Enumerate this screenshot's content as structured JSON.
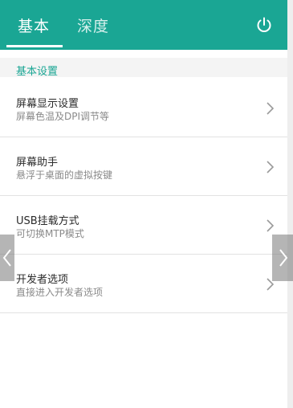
{
  "header": {
    "tabs": [
      {
        "label": "基本"
      },
      {
        "label": "深度"
      }
    ],
    "power_icon": "power-icon",
    "accent_color": "#1aa694"
  },
  "section": {
    "title": "基本设置"
  },
  "items": [
    {
      "title": "屏幕显示设置",
      "subtitle": "屏幕色温及DPI调节等",
      "icon": "chevron-right-icon"
    },
    {
      "title": "屏幕助手",
      "subtitle": "悬浮于桌面的虚拟按键",
      "icon": "chevron-right-icon"
    },
    {
      "title": "USB挂载方式",
      "subtitle": "可切换MTP模式",
      "icon": "chevron-right-icon"
    },
    {
      "title": "开发者选项",
      "subtitle": "直接进入开发者选项",
      "icon": "chevron-right-icon"
    }
  ],
  "nav_arrows": {
    "left_icon": "chevron-left-icon",
    "right_icon": "chevron-right-icon"
  }
}
